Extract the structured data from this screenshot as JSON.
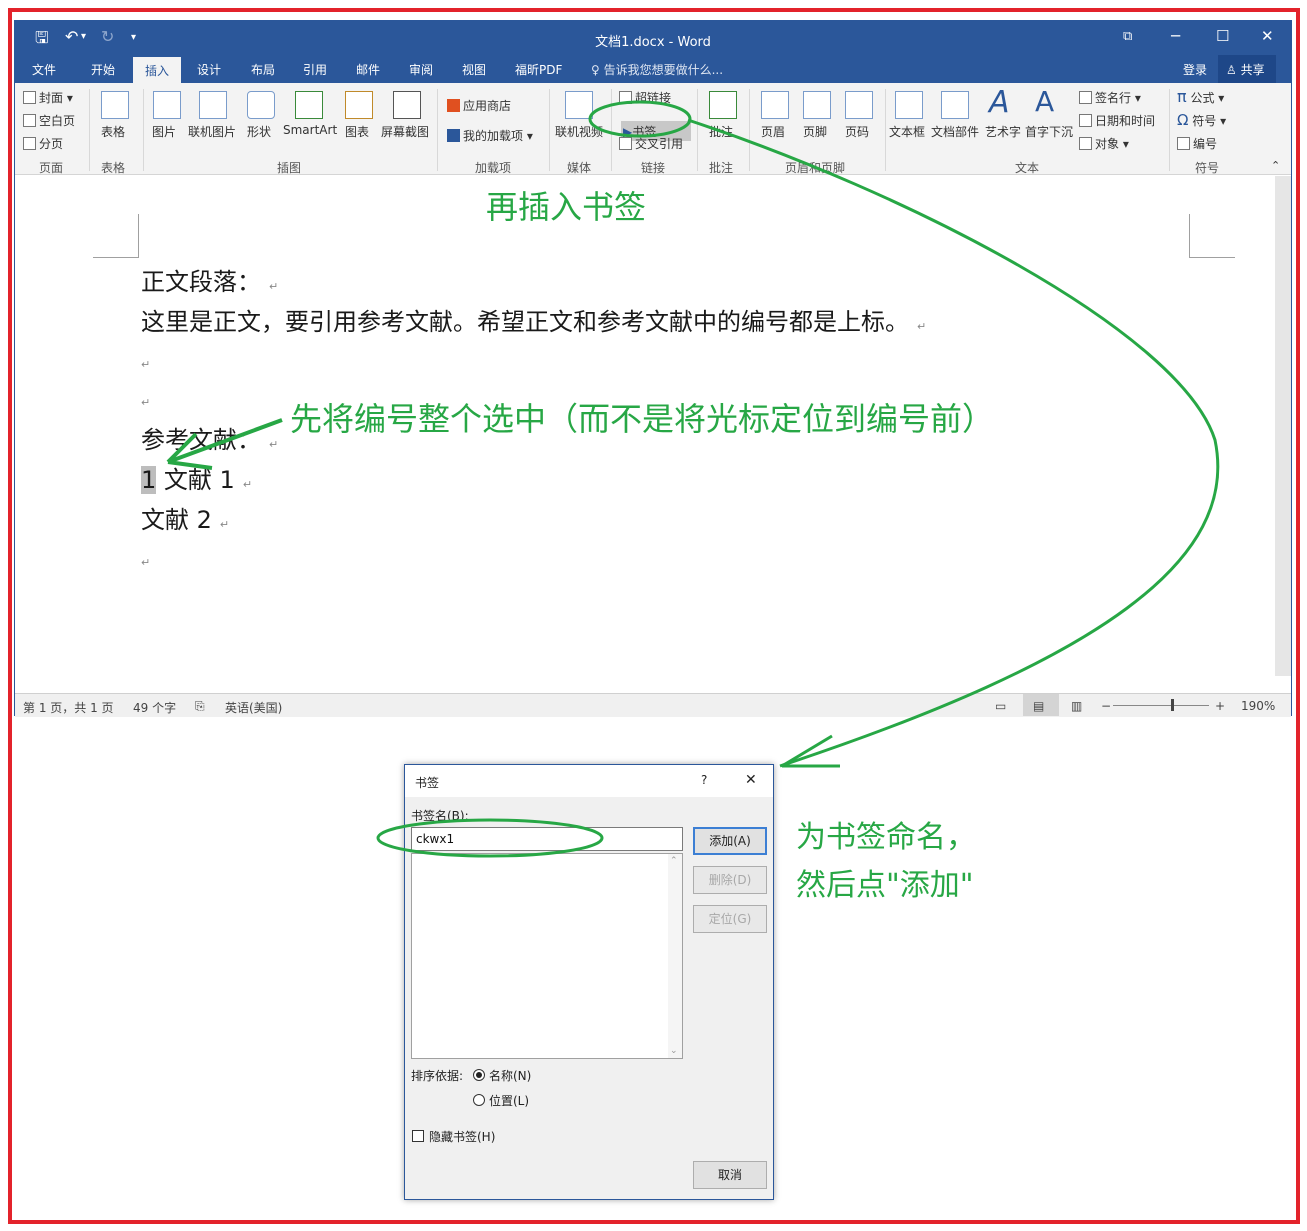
{
  "titlebar": {
    "title": "文档1.docx - Word",
    "save_icon": "save-icon",
    "undo_icon": "undo-icon",
    "redo_icon": "redo-icon"
  },
  "tabs": [
    "文件",
    "开始",
    "插入",
    "设计",
    "布局",
    "引用",
    "邮件",
    "审阅",
    "视图",
    "福昕PDF"
  ],
  "active_tab": "插入",
  "tell_me": "告诉我您想要做什么...",
  "login": "登录",
  "share": "共享",
  "ribbon": {
    "pages": [
      "封面",
      "空白页",
      "分页"
    ],
    "group_pages": "页面",
    "table": "表格",
    "group_table": "表格",
    "illustrations": [
      "图片",
      "联机图片",
      "形状",
      "SmartArt",
      "图表",
      "屏幕截图"
    ],
    "group_illustrations": "插图",
    "addins": [
      "应用商店",
      "我的加载项"
    ],
    "group_addins": "加载项",
    "media": "联机视频",
    "group_media": "媒体",
    "links": [
      "超链接",
      "书签",
      "交叉引用"
    ],
    "group_links": "链接",
    "comment": "批注",
    "group_comments": "批注",
    "header_footer": [
      "页眉",
      "页脚",
      "页码"
    ],
    "group_header_footer": "页眉和页脚",
    "text": [
      "文本框",
      "文档部件",
      "艺术字",
      "首字下沉"
    ],
    "text_small": [
      "签名行",
      "日期和时间",
      "对象"
    ],
    "group_text": "文本",
    "symbols": [
      "公式",
      "符号",
      "编号"
    ],
    "group_symbols": "符号"
  },
  "document": {
    "line1": "正文段落：",
    "line2": "这里是正文，要引用参考文献。希望正文和参考文献中的编号都是上标。",
    "ref_heading": "参考文献：",
    "ref1_num": "1",
    "ref1_text": " 文献 1",
    "ref2_text": "文献 2",
    "para_mark": "↵"
  },
  "status": {
    "page": "第 1 页，共 1 页",
    "words": "49 个字",
    "lang": "英语(美国)",
    "zoom": "190%"
  },
  "dialog": {
    "title": "书签",
    "help": "?",
    "close": "✕",
    "name_label": "书签名(B):",
    "name_value": "ckwx1",
    "add": "添加(A)",
    "delete": "删除(D)",
    "goto": "定位(G)",
    "sort_label": "排序依据:",
    "sort_name": "名称(N)",
    "sort_location": "位置(L)",
    "hidden": "隐藏书签(H)",
    "cancel": "取消"
  },
  "annotations": {
    "insert_bookmark": "再插入书签",
    "select_number": "先将编号整个选中（而不是将光标定位到编号前）",
    "name_line1": "为书签命名，",
    "name_line2": "然后点\"添加\""
  },
  "colors": {
    "word_blue": "#2b579a",
    "annotation_green": "#27a745",
    "frame_red": "#e3232b"
  }
}
